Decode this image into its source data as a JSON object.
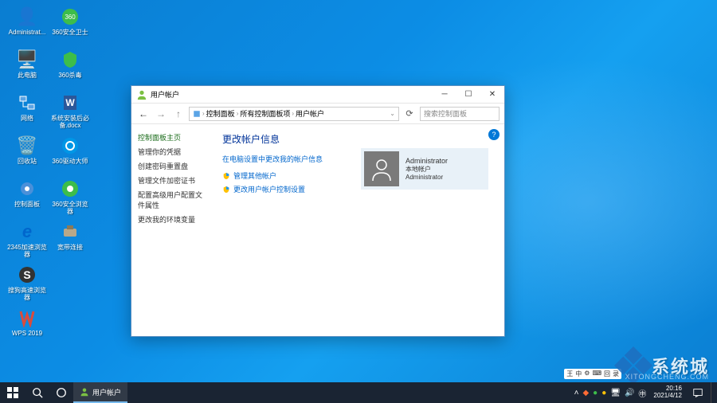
{
  "desktop": {
    "col1": [
      {
        "name": "administrator",
        "label": "Administrat...",
        "icon": "👤",
        "color": "#7bc043"
      },
      {
        "name": "this-pc",
        "label": "此电脑",
        "icon": "🖥️"
      },
      {
        "name": "network",
        "label": "网络",
        "icon": "🌐"
      },
      {
        "name": "recycle-bin",
        "label": "回收站",
        "icon": "🗑️"
      },
      {
        "name": "control-panel",
        "label": "控制面板",
        "icon": "⚙️"
      },
      {
        "name": "browser-2345",
        "label": "2345加速浏览器",
        "icon": "e",
        "color": "#0066cc"
      },
      {
        "name": "sogou-browser",
        "label": "搜狗高速浏览器",
        "icon": "S"
      },
      {
        "name": "wps",
        "label": "WPS 2019",
        "icon": "W",
        "color": "#d84c3e"
      }
    ],
    "col2": [
      {
        "name": "360-safe",
        "label": "360安全卫士",
        "icon": "360",
        "color": "#3dbd4a"
      },
      {
        "name": "360-antivirus",
        "label": "360杀毒",
        "icon": "🛡️",
        "color": "#3dbd4a"
      },
      {
        "name": "system-install",
        "label": "系统安装后必备.docx",
        "icon": "W",
        "color": "#2b579a"
      },
      {
        "name": "360-driver",
        "label": "360驱动大师",
        "icon": "◎",
        "color": "#0097e6"
      },
      {
        "name": "360-browser",
        "label": "360安全浏览器",
        "icon": "◉",
        "color": "#3dbd4a"
      },
      {
        "name": "broadband",
        "label": "宽带连接",
        "icon": "📞"
      }
    ]
  },
  "window": {
    "title": "用户帐户",
    "breadcrumb": [
      "控制面板",
      "所有控制面板项",
      "用户帐户"
    ],
    "search_placeholder": "搜索控制面板",
    "help_tooltip": "?",
    "sidebar": {
      "heading": "控制面板主页",
      "items": [
        "管理你的凭据",
        "创建密码重置盘",
        "管理文件加密证书",
        "配置高级用户配置文件属性",
        "更改我的环境变量"
      ]
    },
    "main": {
      "heading": "更改帐户信息",
      "sublink": "在电脑设置中更改我的帐户信息",
      "links": [
        "管理其他帐户",
        "更改用户帐户控制设置"
      ]
    },
    "user": {
      "name": "Administrator",
      "type": "本地帐户",
      "role": "Administrator"
    }
  },
  "taskbar": {
    "app": "用户帐户",
    "time": "20:16",
    "date": "2021/4/12"
  },
  "watermark": {
    "text": "系统城",
    "url": "XITONGCHENG.COM"
  },
  "ime": {
    "items": [
      "王",
      "中",
      "⚙",
      "⌨",
      "回",
      "录"
    ]
  }
}
